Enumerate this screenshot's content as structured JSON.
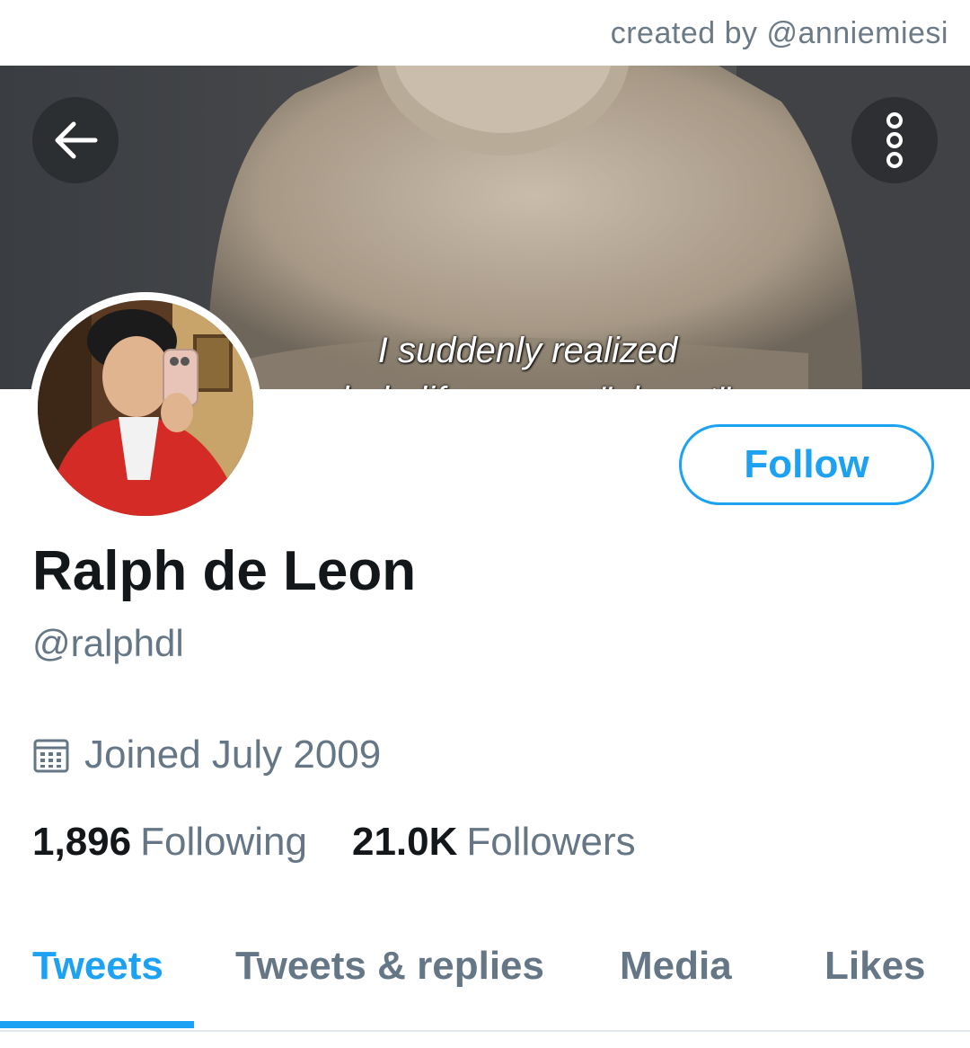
{
  "credit": "created by @anniemiesi",
  "banner": {
    "caption_line1": "I suddenly realized",
    "caption_line2": "my whole life was an \"almost\"."
  },
  "icons": {
    "back": "back-arrow-icon",
    "more": "more-vertical-icon",
    "calendar": "calendar-icon"
  },
  "profile": {
    "name": "Ralph de Leon",
    "handle": "@ralphdl",
    "joined": "Joined July 2009",
    "follow_label": "Follow"
  },
  "stats": {
    "following_count": "1,896",
    "following_label": "Following",
    "followers_count": "21.0K",
    "followers_label": "Followers"
  },
  "tabs": [
    {
      "label": "Tweets",
      "active": true
    },
    {
      "label": "Tweets & replies",
      "active": false
    },
    {
      "label": "Media",
      "active": false
    },
    {
      "label": "Likes",
      "active": false
    }
  ],
  "colors": {
    "accent": "#1da1f2",
    "muted": "#657786",
    "text": "#14171a"
  }
}
